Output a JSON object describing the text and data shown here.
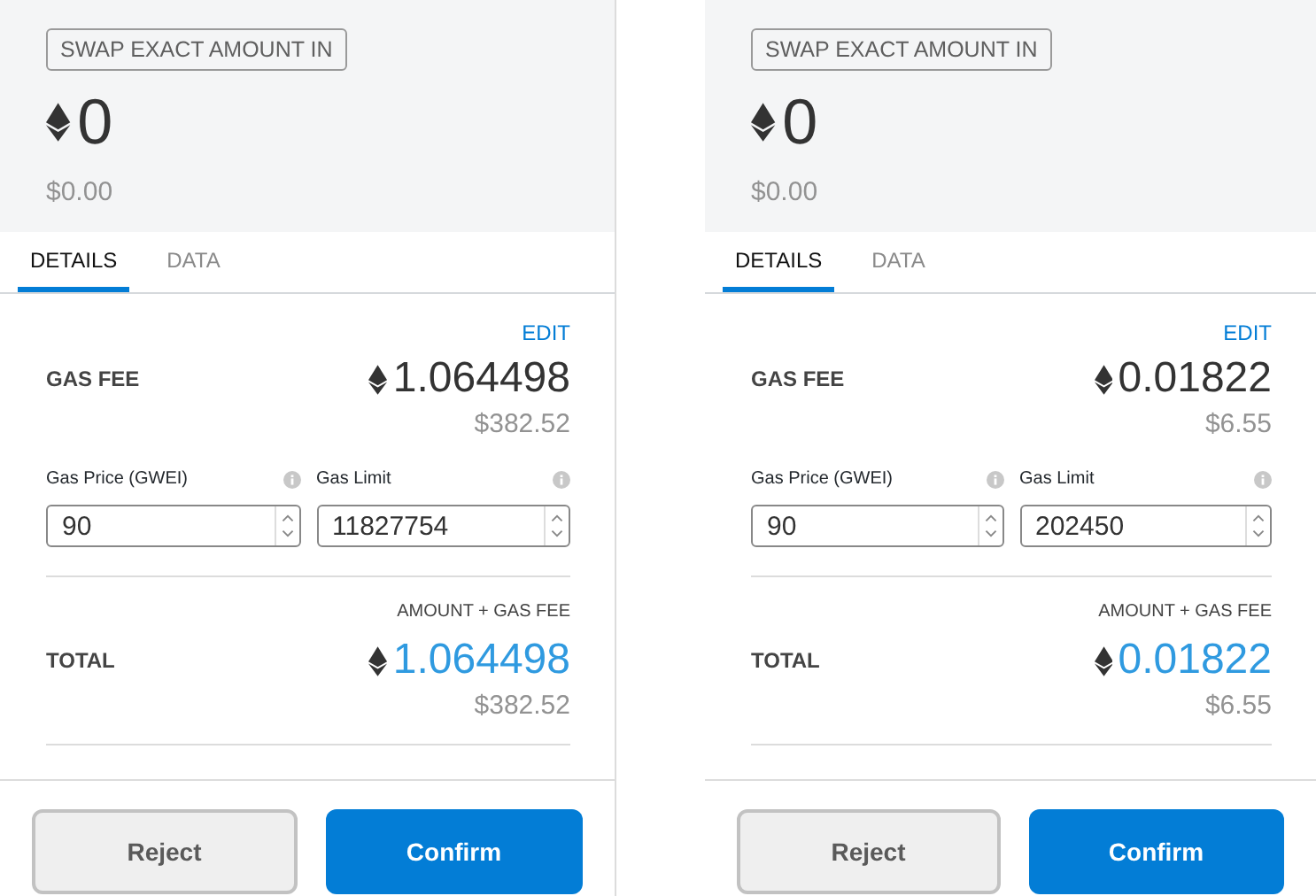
{
  "panels": [
    {
      "badge": "SWAP EXACT AMOUNT IN",
      "amount": "0",
      "fiat": "$0.00",
      "tabs": [
        {
          "label": "DETAILS",
          "selected": true
        },
        {
          "label": "DATA",
          "selected": false
        }
      ],
      "edit": "EDIT",
      "gas_fee": {
        "label": "GAS FEE",
        "amount": "1.064498",
        "fiat": "$382.52"
      },
      "fields": [
        {
          "label": "Gas Price (GWEI)",
          "value": "90"
        },
        {
          "label": "Gas Limit",
          "value": "11827754"
        }
      ],
      "total": {
        "caption": "AMOUNT + GAS FEE",
        "label": "TOTAL",
        "amount": "1.064498",
        "fiat": "$382.52"
      },
      "buttons": [
        {
          "kind": "secondary",
          "label": "Reject"
        },
        {
          "kind": "primary",
          "label": "Confirm"
        }
      ]
    },
    {
      "badge": "SWAP EXACT AMOUNT IN",
      "amount": "0",
      "fiat": "$0.00",
      "tabs": [
        {
          "label": "DETAILS",
          "selected": true
        },
        {
          "label": "DATA",
          "selected": false
        }
      ],
      "edit": "EDIT",
      "gas_fee": {
        "label": "GAS FEE",
        "amount": "0.01822",
        "fiat": "$6.55"
      },
      "fields": [
        {
          "label": "Gas Price (GWEI)",
          "value": "90"
        },
        {
          "label": "Gas Limit",
          "value": "202450"
        }
      ],
      "total": {
        "caption": "AMOUNT + GAS FEE",
        "label": "TOTAL",
        "amount": "0.01822",
        "fiat": "$6.55"
      },
      "buttons": [
        {
          "kind": "secondary",
          "label": "Reject"
        },
        {
          "kind": "primary",
          "label": "Confirm"
        }
      ]
    }
  ]
}
